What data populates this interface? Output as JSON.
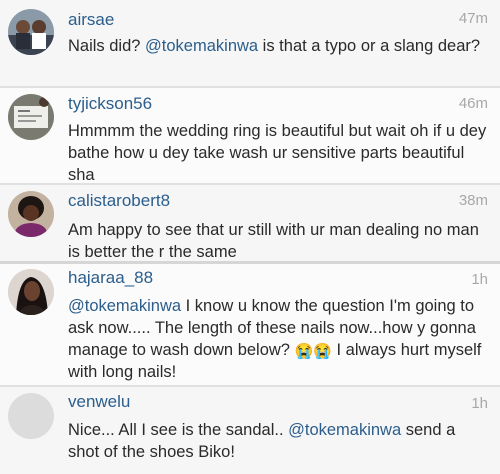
{
  "comments": [
    {
      "username": "airsae",
      "time": "47m",
      "text_parts": [
        "Nails did? ",
        "@tokemakinwa",
        " is that a typo or a slang dear?"
      ]
    },
    {
      "username": "tyjickson56",
      "time": "46m",
      "text": "Hmmmm the wedding ring is beautiful but wait oh if u dey bathe how u dey take wash ur sensitive parts beautiful sha"
    },
    {
      "username": "calistarobert8",
      "time": "38m",
      "text": "Am happy to see that ur still with ur man dealing no man is better the r the same"
    },
    {
      "username": "hajaraa_88",
      "time": "1h",
      "text_parts": [
        "@tokemakinwa",
        " I know u know the question I'm going to ask now..... The length of these nails now...how y gonna manage to wash down below? ",
        "😭😭",
        " I always hurt myself with long nails!"
      ]
    },
    {
      "username": "venwelu",
      "time": "1h",
      "text_parts": [
        "Nice... All I see is the sandal.. ",
        "@tokemakinwa",
        " send a shot of the shoes Biko!"
      ]
    }
  ]
}
